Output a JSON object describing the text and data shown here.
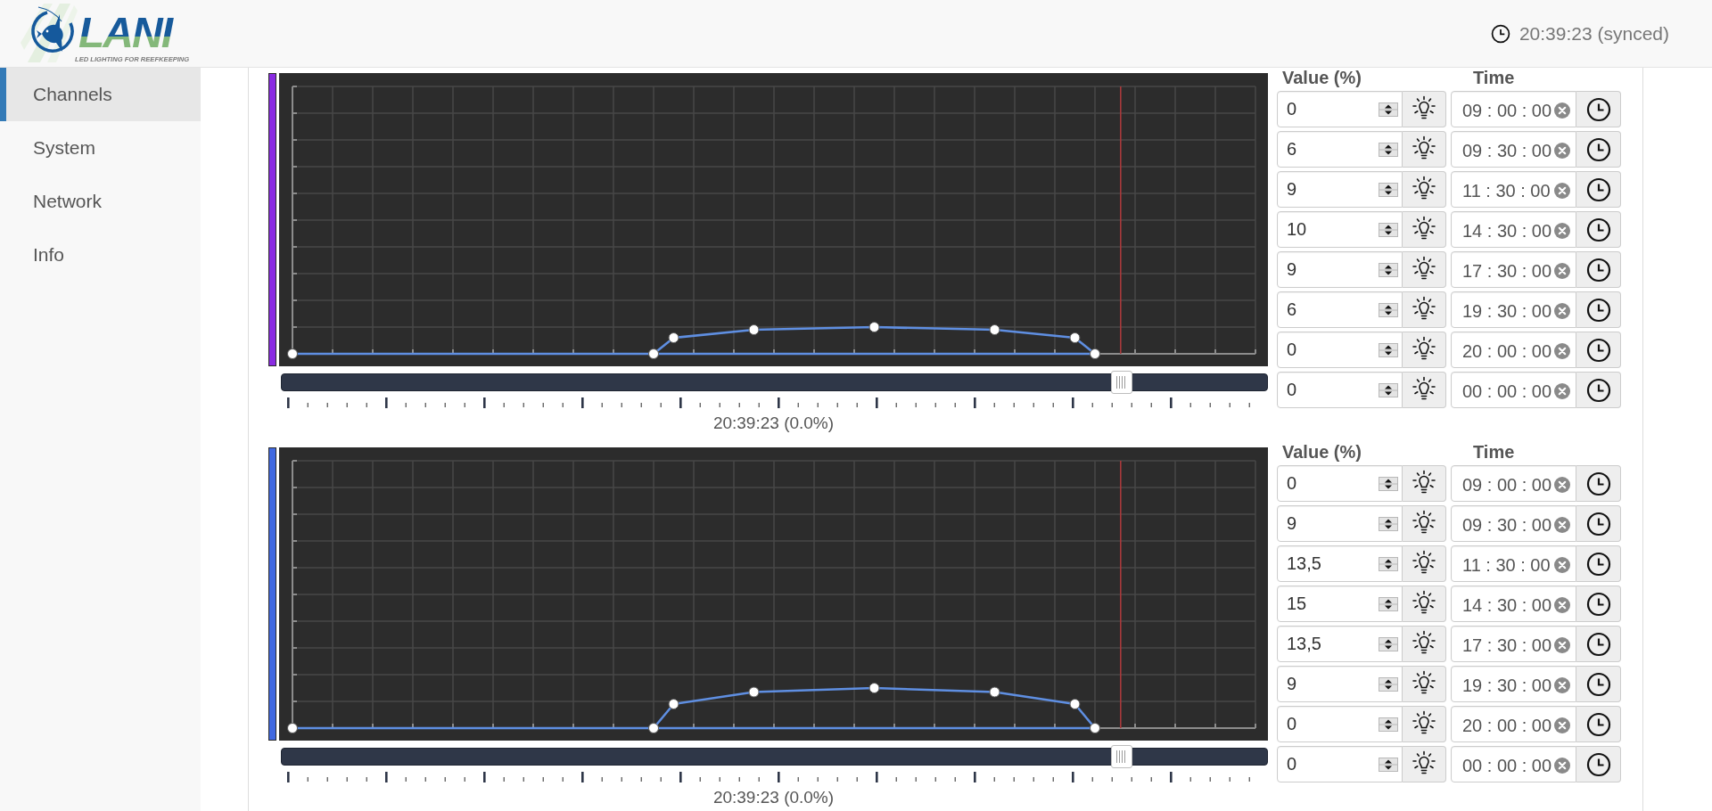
{
  "header": {
    "logo": {
      "name": "LANI",
      "tagline": "LED LIGHTING FOR REEFKEEPING"
    },
    "clock": "20:39:23 (synced)"
  },
  "sidebar": {
    "items": [
      {
        "label": "Channels",
        "selected": true
      },
      {
        "label": "System",
        "selected": false
      },
      {
        "label": "Network",
        "selected": false
      },
      {
        "label": "Info",
        "selected": false
      }
    ]
  },
  "channels": [
    {
      "color": "#8a2be2",
      "columns": {
        "value": "Value (%)",
        "time": "Time"
      },
      "entries": [
        {
          "value": "0",
          "time": "09 : 00 : 00"
        },
        {
          "value": "6",
          "time": "09 : 30 : 00"
        },
        {
          "value": "9",
          "time": "11 : 30 : 00"
        },
        {
          "value": "10",
          "time": "14 : 30 : 00"
        },
        {
          "value": "9",
          "time": "17 : 30 : 00"
        },
        {
          "value": "6",
          "time": "19 : 30 : 00"
        },
        {
          "value": "0",
          "time": "20 : 00 : 00"
        },
        {
          "value": "0",
          "time": "00 : 00 : 00"
        }
      ],
      "slider": {
        "level": 0.86
      },
      "current": "20:39:23 (0.0%)"
    },
    {
      "color": "#4169e1",
      "columns": {
        "value": "Value (%)",
        "time": "Time"
      },
      "entries": [
        {
          "value": "0",
          "time": "09 : 00 : 00"
        },
        {
          "value": "9",
          "time": "09 : 30 : 00"
        },
        {
          "value": "13,5",
          "time": "11 : 30 : 00"
        },
        {
          "value": "15",
          "time": "14 : 30 : 00"
        },
        {
          "value": "13,5",
          "time": "17 : 30 : 00"
        },
        {
          "value": "9",
          "time": "19 : 30 : 00"
        },
        {
          "value": "0",
          "time": "20 : 00 : 00"
        },
        {
          "value": "0",
          "time": "00 : 00 : 00"
        }
      ],
      "slider": {
        "level": 0.86
      },
      "current": "20:39:23 (0.0%)"
    }
  ]
}
